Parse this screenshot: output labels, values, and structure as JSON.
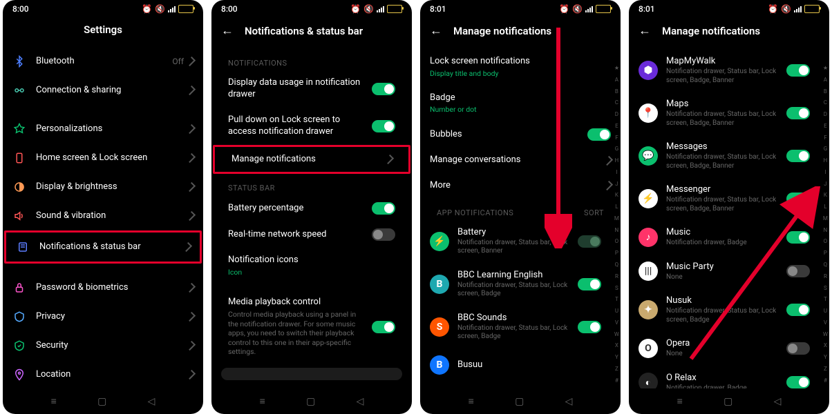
{
  "status": {
    "time1": "8:00",
    "time2": "8:01"
  },
  "alpha": [
    "★",
    "A",
    "B",
    "C",
    "D",
    "E",
    "F",
    "G",
    "H",
    "I",
    "J",
    "K",
    "L",
    "M",
    "N",
    "O",
    "P",
    "Q",
    "R",
    "S",
    "T",
    "U",
    "V",
    "W",
    "X",
    "Y",
    "Z",
    "#"
  ],
  "screen1": {
    "title": "Settings",
    "items": [
      {
        "name": "bluetooth",
        "label": "Bluetooth",
        "trailing": "Off",
        "chev": true
      },
      {
        "name": "connection",
        "label": "Connection & sharing",
        "chev": true
      },
      {
        "name": "personalizations",
        "label": "Personalizations",
        "chev": true
      },
      {
        "name": "homescreen",
        "label": "Home screen & Lock screen",
        "chev": true
      },
      {
        "name": "display",
        "label": "Display & brightness",
        "chev": true
      },
      {
        "name": "sound",
        "label": "Sound & vibration",
        "chev": true
      },
      {
        "name": "notifications",
        "label": "Notifications & status bar",
        "chev": true,
        "highlight": true
      },
      {
        "name": "password",
        "label": "Password & biometrics",
        "chev": true
      },
      {
        "name": "privacy",
        "label": "Privacy",
        "chev": true
      },
      {
        "name": "security",
        "label": "Security",
        "chev": true
      },
      {
        "name": "location",
        "label": "Location",
        "chev": true
      }
    ]
  },
  "screen2": {
    "title": "Notifications & status bar",
    "section1": "NOTIFICATIONS",
    "section2": "STATUS BAR",
    "items1": [
      {
        "label": "Display data usage in notification drawer",
        "toggle": "on"
      },
      {
        "label": "Pull down on Lock screen to access notification drawer",
        "toggle": "on"
      },
      {
        "label": "Manage notifications",
        "chev": true,
        "highlight": true
      }
    ],
    "items2": [
      {
        "label": "Battery percentage",
        "toggle": "on"
      },
      {
        "label": "Real-time network speed",
        "toggle": "off"
      },
      {
        "label": "Notification icons",
        "sub": "Icon",
        "subgreen": true
      }
    ],
    "media": {
      "label": "Media playback control",
      "sub": "Control media playback using a panel in the notification drawer. For some music apps, you need to switch their playback control to this one in their app-specific settings.",
      "toggle": "on"
    }
  },
  "screen3": {
    "title": "Manage notifications",
    "top": [
      {
        "label": "Lock screen notifications",
        "sub": "Display title and body",
        "subgreen": true
      },
      {
        "label": "Badge",
        "sub": "Number or dot",
        "subgreen": true
      },
      {
        "label": "Bubbles",
        "toggle": "on"
      },
      {
        "label": "Manage conversations",
        "chev": true
      },
      {
        "label": "More",
        "chev": true
      }
    ],
    "section": "APP NOTIFICATIONS",
    "sort": "SORT",
    "apps": [
      {
        "name": "Battery",
        "sub": "Notification drawer, Status bar, Lock screen, Banner",
        "toggle": "dim",
        "bg": "#0bbf6e",
        "initial": "⚡"
      },
      {
        "name": "BBC Learning English",
        "sub": "Notification drawer, Status bar, Lock screen, Badge",
        "toggle": "on",
        "bg": "#1ea8b0",
        "initial": "B"
      },
      {
        "name": "BBC Sounds",
        "sub": "Notification drawer, Status bar, Lock screen, Badge",
        "toggle": "on",
        "bg": "#ff5500",
        "initial": "S"
      },
      {
        "name": "Busuu",
        "sub": "",
        "bg": "#0f75ff"
      }
    ]
  },
  "screen4": {
    "title": "Manage notifications",
    "apps": [
      {
        "name": "MapMyWalk",
        "sub": "Notification drawer, Status bar, Lock screen, Badge, Banner",
        "toggle": "on",
        "bg": "#6a2bd9",
        "initial": "⬢"
      },
      {
        "name": "Maps",
        "sub": "Notification drawer, Status bar, Lock screen, Badge, Banner",
        "toggle": "on",
        "bg": "#ffffff",
        "initial": "📍"
      },
      {
        "name": "Messages",
        "sub": "Notification drawer, Status bar, Lock screen, Badge, Banner",
        "toggle": "on",
        "bg": "#0bbf6e",
        "initial": "💬"
      },
      {
        "name": "Messenger",
        "sub": "Notification drawer, Status bar, Lock screen, Badge, Banner",
        "toggle": "on",
        "bg": "#ffffff",
        "initial": "⚡"
      },
      {
        "name": "Music",
        "sub": "Notification drawer, Badge",
        "toggle": "on",
        "bg": "#ff3369",
        "initial": "♪"
      },
      {
        "name": "Music Party",
        "sub": "None",
        "toggle": "off",
        "bg": "#ffffff",
        "initial": "|||"
      },
      {
        "name": "Nusuk",
        "sub": "Notification drawer, Status bar, Lock screen, Badge",
        "toggle": "on",
        "bg": "#c9a96e",
        "initial": "✦"
      },
      {
        "name": "Opera",
        "sub": "None",
        "toggle": "off",
        "bg": "#ffffff",
        "initial": "O"
      },
      {
        "name": "O Relax",
        "sub": "Notification drawer, Badge",
        "toggle": "on",
        "bg": "#222",
        "initial": "◐"
      }
    ]
  }
}
